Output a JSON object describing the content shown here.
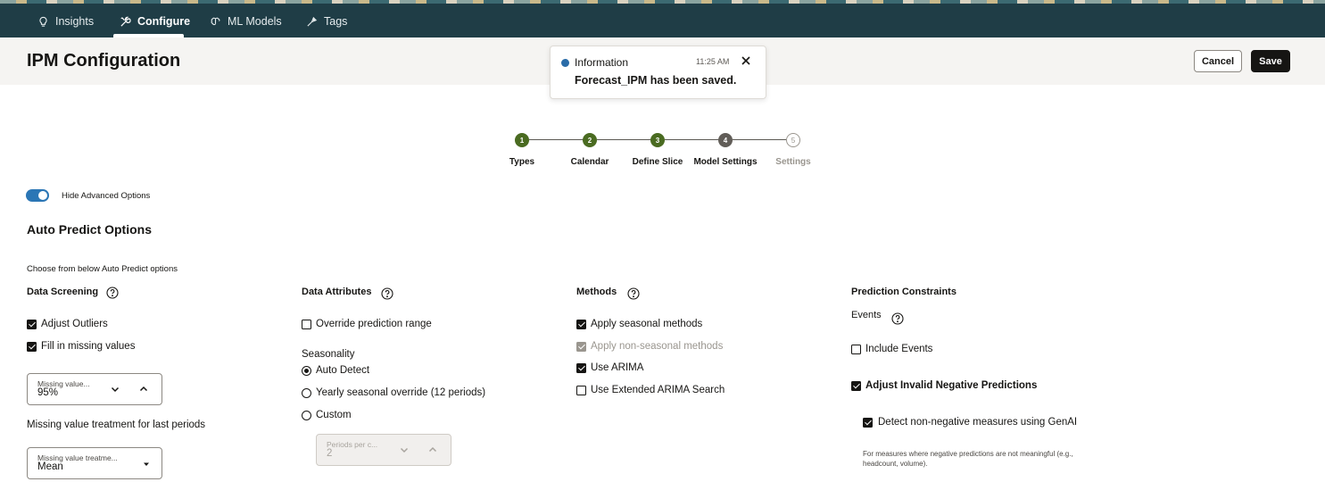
{
  "nav": {
    "tabs": [
      {
        "label": "Insights",
        "icon": "lightbulb-icon"
      },
      {
        "label": "Configure",
        "icon": "tools-icon",
        "active": true
      },
      {
        "label": "ML Models",
        "icon": "brain-icon"
      },
      {
        "label": "Tags",
        "icon": "tag-icon"
      }
    ]
  },
  "header": {
    "title": "IPM Configuration",
    "cancel_label": "Cancel",
    "save_label": "Save"
  },
  "toast": {
    "title": "Information",
    "time": "11:25 AM",
    "message": "Forecast_IPM has been saved."
  },
  "stepper": {
    "steps": [
      {
        "number": "1",
        "label": "Types",
        "state": "done"
      },
      {
        "number": "2",
        "label": "Calendar",
        "state": "done"
      },
      {
        "number": "3",
        "label": "Define Slice",
        "state": "done"
      },
      {
        "number": "4",
        "label": "Model Settings",
        "state": "current"
      },
      {
        "number": "5",
        "label": "Settings",
        "state": "future"
      }
    ]
  },
  "advanced_toggle": {
    "label": "Hide Advanced Options",
    "on": true
  },
  "section": {
    "title": "Auto Predict Options",
    "subtitle": "Choose from below Auto Predict options"
  },
  "data_screening": {
    "title": "Data Screening",
    "adjust_outliers": {
      "label": "Adjust Outliers",
      "checked": true
    },
    "fill_missing": {
      "label": "Fill in missing values",
      "checked": true
    },
    "missing_value_select": {
      "label": "Missing value...",
      "value": "95%"
    },
    "last_periods_label": "Missing value treatment for last periods",
    "treatment_select": {
      "label": "Missing value treatme...",
      "value": "Mean"
    }
  },
  "data_attributes": {
    "title": "Data Attributes",
    "override_range": {
      "label": "Override prediction range",
      "checked": false
    },
    "seasonality_label": "Seasonality",
    "radios": [
      {
        "label": "Auto Detect",
        "checked": true
      },
      {
        "label": "Yearly seasonal override (12 periods)",
        "checked": false
      },
      {
        "label": "Custom",
        "checked": false
      }
    ],
    "periods_field": {
      "label": "Periods per c...",
      "value": "2"
    }
  },
  "methods": {
    "title": "Methods",
    "items": [
      {
        "label": "Apply seasonal methods",
        "checked": true,
        "disabled": false
      },
      {
        "label": "Apply non-seasonal methods",
        "checked": true,
        "disabled": true
      },
      {
        "label": "Use ARIMA",
        "checked": true,
        "disabled": false
      },
      {
        "label": "Use Extended ARIMA Search",
        "checked": false,
        "disabled": false
      }
    ]
  },
  "prediction_constraints": {
    "title": "Prediction Constraints",
    "events_label": "Events",
    "include_events": {
      "label": "Include Events",
      "checked": false
    },
    "adjust_negative": {
      "label": "Adjust Invalid Negative Predictions",
      "checked": true
    },
    "detect_genai": {
      "label": "Detect non-negative measures using GenAI",
      "checked": true
    },
    "help_line1": "For measures where negative predictions are not meaningful (e.g.,",
    "help_line2": "headcount, volume)."
  },
  "colors": {
    "nav_bg": "#1f3d46",
    "step_done": "#4a6b21",
    "toggle_on": "#2b76b5",
    "info_blue": "#2a6ca8"
  }
}
